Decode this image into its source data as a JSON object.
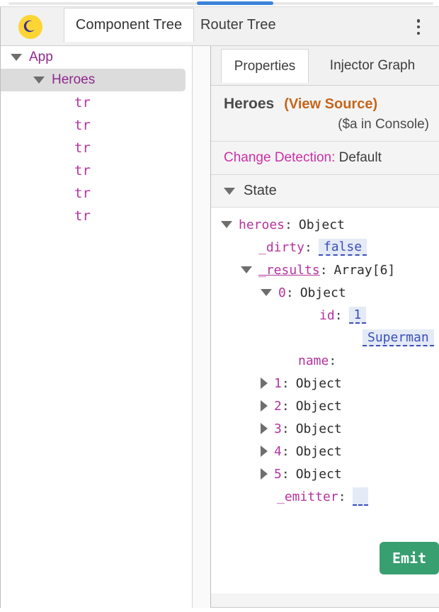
{
  "header": {
    "logo_icon": "angular-devtools-moon-icon",
    "tabs": [
      {
        "label": "Component Tree",
        "active": true
      },
      {
        "label": "Router Tree",
        "active": false
      }
    ],
    "menu_icon": "kebab-menu-icon"
  },
  "component_tree": {
    "nodes": [
      {
        "label": "App",
        "indent": 0,
        "expanded": true,
        "selected": false,
        "kind": "component"
      },
      {
        "label": "Heroes",
        "indent": 1,
        "expanded": true,
        "selected": true,
        "kind": "component"
      },
      {
        "label": "tr",
        "indent": 2,
        "expanded": null,
        "selected": false,
        "kind": "element"
      },
      {
        "label": "tr",
        "indent": 2,
        "expanded": null,
        "selected": false,
        "kind": "element"
      },
      {
        "label": "tr",
        "indent": 2,
        "expanded": null,
        "selected": false,
        "kind": "element"
      },
      {
        "label": "tr",
        "indent": 2,
        "expanded": null,
        "selected": false,
        "kind": "element"
      },
      {
        "label": "tr",
        "indent": 2,
        "expanded": null,
        "selected": false,
        "kind": "element"
      },
      {
        "label": "tr",
        "indent": 2,
        "expanded": null,
        "selected": false,
        "kind": "element"
      }
    ]
  },
  "properties_pane": {
    "tabs": [
      {
        "label": "Properties",
        "active": true
      },
      {
        "label": "Injector Graph",
        "active": false
      }
    ],
    "component_name": "Heroes",
    "view_source_label": "(View Source)",
    "console_note": "($a in Console)",
    "change_detection_label": "Change Detection:",
    "change_detection_value": "Default",
    "state_section_label": "State",
    "emit_button_label": "Emit",
    "state_rows": [
      {
        "key": "heroes",
        "value": "Object",
        "indent": 0,
        "expander": "down",
        "editable": null,
        "underline": false
      },
      {
        "key": "_dirty",
        "value": "",
        "indent": 1,
        "expander": "none",
        "editable": "false",
        "underline": false
      },
      {
        "key": "_results",
        "value": "Array[6]",
        "indent": 1,
        "expander": "down",
        "editable": null,
        "underline": true
      },
      {
        "key": "0",
        "value": "Object",
        "indent": 2,
        "expander": "down",
        "editable": null,
        "underline": false
      },
      {
        "key": "id",
        "value": "",
        "indent": 3,
        "expander": "none",
        "editable": "1",
        "underline": false
      },
      {
        "key": "",
        "value": "",
        "indent": 4,
        "expander": "none",
        "editable": "Superman",
        "underline": false
      },
      {
        "key": "name",
        "value": "",
        "indent": 2,
        "expander": "none",
        "editable": null,
        "underline": false
      },
      {
        "key": "1",
        "value": "Object",
        "indent": 2,
        "expander": "right",
        "editable": null,
        "underline": false
      },
      {
        "key": "2",
        "value": "Object",
        "indent": 2,
        "expander": "right",
        "editable": null,
        "underline": false
      },
      {
        "key": "3",
        "value": "Object",
        "indent": 2,
        "expander": "right",
        "editable": null,
        "underline": false
      },
      {
        "key": "4",
        "value": "Object",
        "indent": 2,
        "expander": "right",
        "editable": null,
        "underline": false
      },
      {
        "key": "5",
        "value": "Object",
        "indent": 2,
        "expander": "right",
        "editable": null,
        "underline": false
      },
      {
        "key": "_emitter",
        "value": "",
        "indent": 1,
        "expander": "none",
        "editable": "",
        "underline": false
      }
    ]
  },
  "colors": {
    "accent_blue": "#3b82d9",
    "view_source_orange": "#c4651b",
    "key_magenta": "#b5339e",
    "change_detection_pink": "#cc2fa6",
    "emit_green": "#389f70",
    "editable_blue": "#3b4fb8",
    "logo_yellow": "#fcd535"
  }
}
